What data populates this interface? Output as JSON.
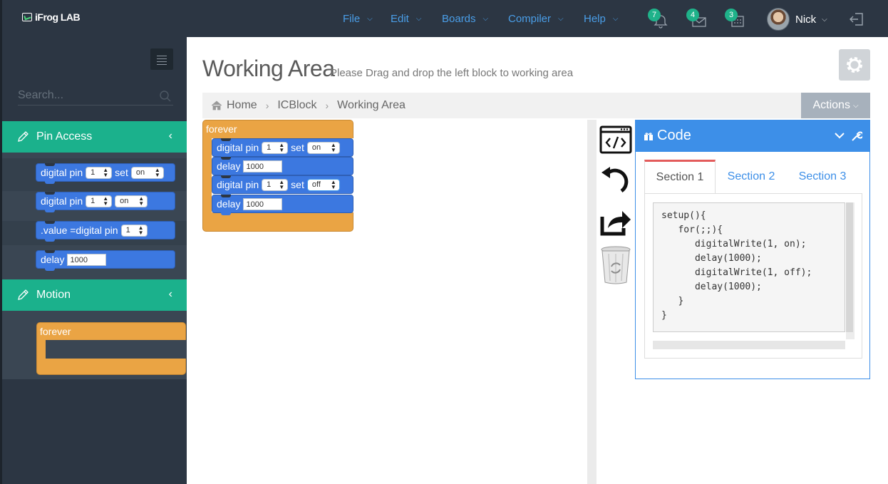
{
  "app": {
    "logo_text": "iFrog LAB"
  },
  "menu": [
    {
      "label": "File"
    },
    {
      "label": "Edit"
    },
    {
      "label": "Boards"
    },
    {
      "label": "Compiler"
    },
    {
      "label": "Help"
    }
  ],
  "notifications": [
    {
      "icon": "bell-icon",
      "count": "7"
    },
    {
      "icon": "envelope-icon",
      "count": "4"
    },
    {
      "icon": "calendar-icon",
      "count": "3"
    }
  ],
  "user": {
    "name": "Nick"
  },
  "sidebar": {
    "search_placeholder": "Search...",
    "sections": [
      {
        "title": "Pin Access",
        "blocks": [
          {
            "text": "digital pin",
            "pin": "1",
            "set_label": "set",
            "state": "on"
          },
          {
            "text": "digital pin",
            "pin": "1",
            "state": "on"
          },
          {
            "text": ".value =digital pin",
            "pin": "1"
          },
          {
            "text": "delay",
            "value": "1000"
          }
        ]
      },
      {
        "title": "Motion",
        "blocks": [
          {
            "text": "forever"
          }
        ]
      }
    ]
  },
  "main": {
    "title": "Working Area",
    "subtitle": "Please Drag and drop the left block to working area",
    "breadcrumb": [
      "Home",
      "ICBlock",
      "Working Area"
    ],
    "actions_label": "Actions"
  },
  "workspace": {
    "forever_label": "forever",
    "blocks": [
      {
        "text": "digital pin",
        "pin": "1",
        "set_label": "set",
        "state": "on"
      },
      {
        "text": "delay",
        "value": "1000"
      },
      {
        "text": "digital pin",
        "pin": "1",
        "set_label": "set",
        "state": "off"
      },
      {
        "text": "delay",
        "value": "1000"
      }
    ]
  },
  "code_panel": {
    "title": "Code",
    "tabs": [
      "Section 1",
      "Section 2",
      "Section 3"
    ],
    "active_tab": "Section 1",
    "code": "setup(){\n   for(;;){\n      digitalWrite(1, on);\n      delay(1000);\n      digitalWrite(1, off);\n      delay(1000);\n   }\n}"
  },
  "colors": {
    "sidebar_bg": "#2c3643",
    "section_header": "#1bb18c",
    "block_blue": "#3c78e0",
    "block_orange": "#eaa444",
    "accent_blue": "#3d8fe8",
    "active_tab_border": "#e35b5b"
  }
}
